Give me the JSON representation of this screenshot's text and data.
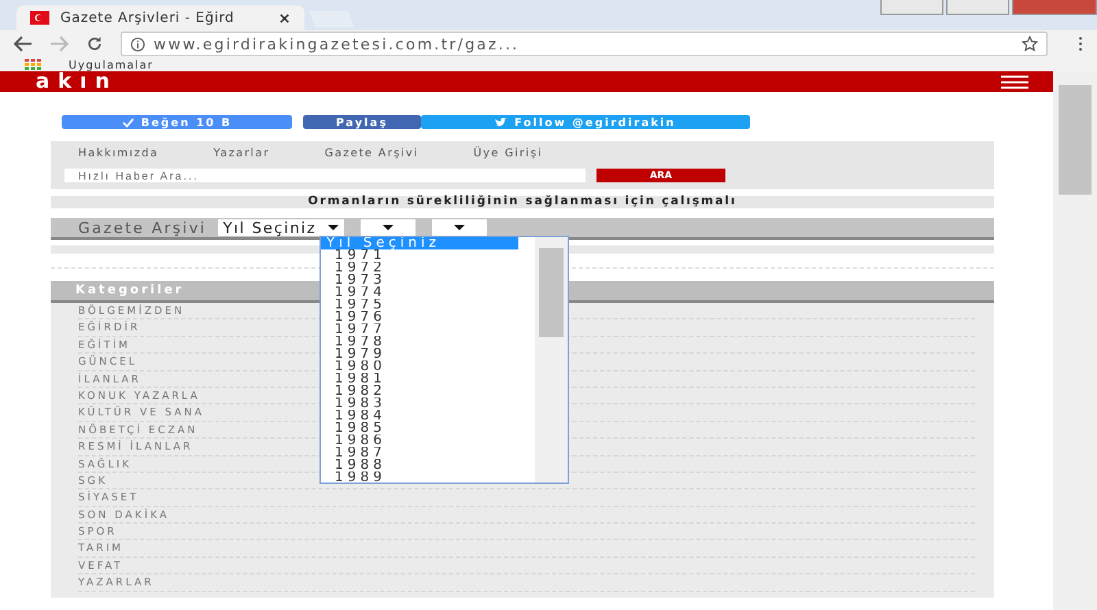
{
  "browser": {
    "tab_title": "Gazete Arşivleri - Eğird",
    "url": "www.egirdirakingazetesi.com.tr/gaz...",
    "bookmark": "Uygulamalar"
  },
  "site": {
    "logo": "akın",
    "social": [
      {
        "kind": "like",
        "label": "Beğen 10 B"
      },
      {
        "kind": "share",
        "label": "Paylaş"
      },
      {
        "kind": "twitter",
        "label": "Follow @egirdirakin"
      }
    ],
    "nav": [
      "Hakkımızda",
      "Yazarlar",
      "Gazete Arşivi",
      "Üye Girişi"
    ],
    "search": {
      "placeholder": "Hızlı Haber Ara...",
      "button": "ARA"
    },
    "slogan": "Ormanların sürekliliğinin sağlanması için çalışmalı",
    "archive": {
      "label": "Gazete Arşivi",
      "year_select": "Yıl Seçiniz",
      "year_options": [
        {
          "label": "Yıl Seçiniz",
          "selected": true
        },
        {
          "label": "1971",
          "selected": false
        },
        {
          "label": "1972",
          "selected": false
        },
        {
          "label": "1973",
          "selected": false
        },
        {
          "label": "1974",
          "selected": false
        },
        {
          "label": "1975",
          "selected": false
        },
        {
          "label": "1976",
          "selected": false
        },
        {
          "label": "1977",
          "selected": false
        },
        {
          "label": "1978",
          "selected": false
        },
        {
          "label": "1979",
          "selected": false
        },
        {
          "label": "1980",
          "selected": false
        },
        {
          "label": "1981",
          "selected": false
        },
        {
          "label": "1982",
          "selected": false
        },
        {
          "label": "1983",
          "selected": false
        },
        {
          "label": "1984",
          "selected": false
        },
        {
          "label": "1985",
          "selected": false
        },
        {
          "label": "1986",
          "selected": false
        },
        {
          "label": "1987",
          "selected": false
        },
        {
          "label": "1988",
          "selected": false
        },
        {
          "label": "1989",
          "selected": false
        }
      ]
    },
    "categories": {
      "title": "Kategoriler",
      "items": [
        "BÖLGEMİZDEN",
        "EĞİRDİR",
        "EĞİTİM",
        "GÜNCEL",
        "İLANLAR",
        "KONUK YAZARLA",
        "KÜLTÜR VE SANA",
        "NÖBETÇİ ECZAN",
        "RESMİ İLANLAR",
        "SAĞLIK",
        "SGK",
        "SİYASET",
        "SON DAKİKA",
        "SPOR",
        "TARIM",
        "VEFAT",
        "YAZARLAR"
      ]
    }
  }
}
